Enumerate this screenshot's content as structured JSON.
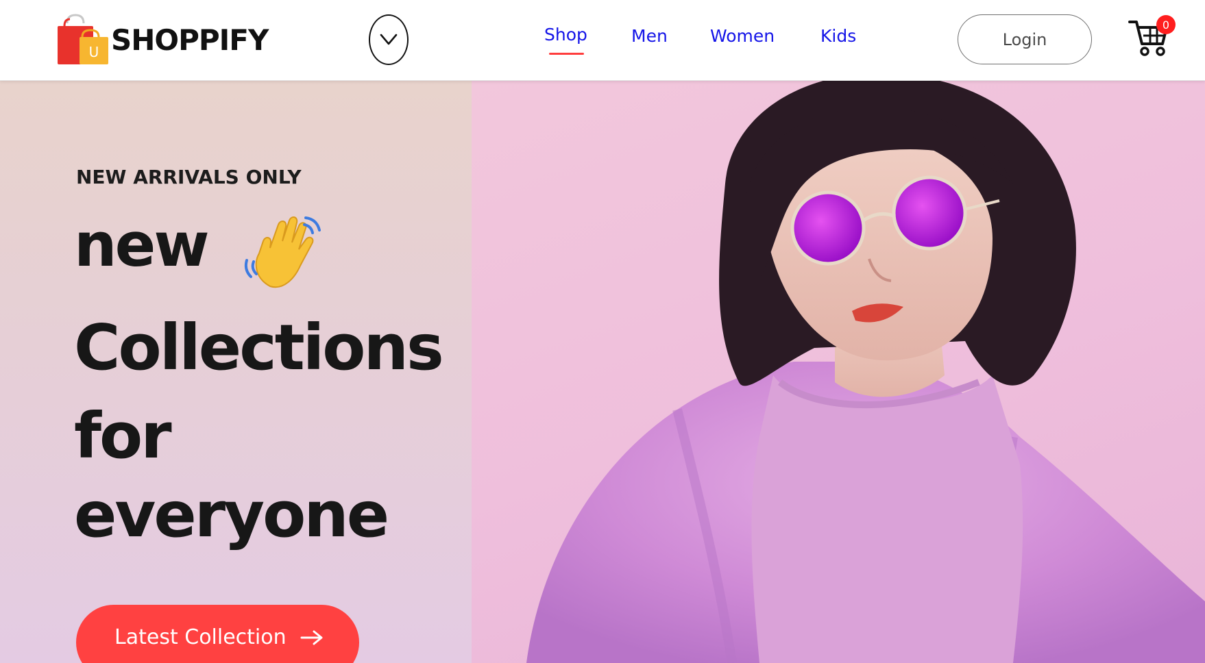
{
  "header": {
    "brand": "SHOPPIFY",
    "logo_letter": "U",
    "nav": [
      {
        "label": "Shop",
        "active": true
      },
      {
        "label": "Men",
        "active": false
      },
      {
        "label": "Women",
        "active": false
      },
      {
        "label": "Kids",
        "active": false
      }
    ],
    "login_label": "Login",
    "cart_count": "0"
  },
  "hero": {
    "tag": "NEW ARRIVALS ONLY",
    "headline": [
      "new",
      "Collections",
      "for",
      "everyone"
    ],
    "cta_label": "Latest Collection"
  },
  "icons": {
    "logo": "shopping-bag-icon",
    "dropdown": "chevron-down-icon",
    "cart": "cart-icon",
    "wave": "waving-hand-icon",
    "cta_arrow": "arrow-right-icon"
  },
  "colors": {
    "nav_link": "#1414e8",
    "active_underline": "#ff3d3d",
    "cta_background": "#ff4141",
    "badge": "#ff1e1e",
    "headline": "#171717"
  }
}
